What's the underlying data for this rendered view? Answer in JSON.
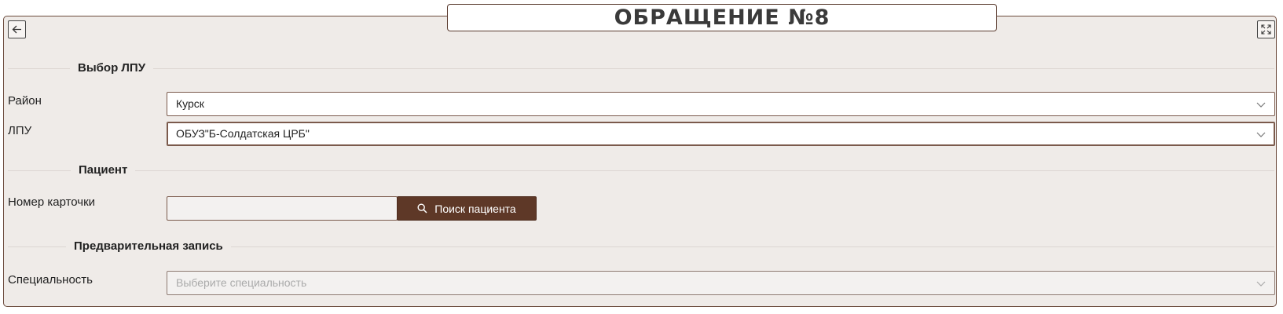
{
  "header": {
    "title": "ОБРАЩЕНИЕ №8",
    "back_icon": "arrow-left-icon",
    "expand_icon": "expand-icon"
  },
  "sections": {
    "lpu_choice": "Выбор ЛПУ",
    "patient": "Пациент",
    "appointment": "Предварительная запись"
  },
  "fields": {
    "district": {
      "label": "Район",
      "value": "Курск"
    },
    "lpu": {
      "label": "ЛПУ",
      "value": "ОБУЗ\"Б-Солдатская ЦРБ\""
    },
    "card_number": {
      "label": "Номер карточки",
      "value": ""
    },
    "specialty": {
      "label": "Специальность",
      "placeholder": "Выберите специальность"
    }
  },
  "buttons": {
    "search_patient": "Поиск пациента"
  },
  "colors": {
    "accent": "#5e3827",
    "panel_bg": "#efebe8",
    "border": "#6b4a3c"
  }
}
